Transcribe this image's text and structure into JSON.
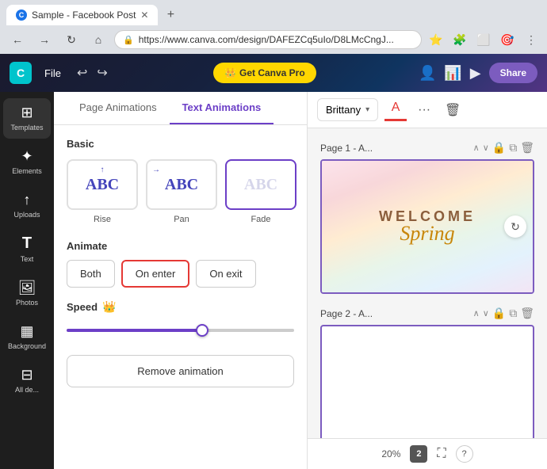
{
  "browser": {
    "tab_title": "Sample - Facebook Post",
    "favicon_letter": "C",
    "url": "https://www.canva.com/design/DAFEZCq5uIo/D8LMcCngJ...",
    "new_tab_icon": "+",
    "back_icon": "←",
    "forward_icon": "→",
    "refresh_icon": "↻",
    "home_icon": "⌂",
    "lock_icon": "🔒"
  },
  "toolbar": {
    "logo_letter": "C",
    "file_label": "File",
    "undo_icon": "↩",
    "redo_icon": "↪",
    "canva_pro_label": "Get Canva Pro",
    "crown_icon": "👑",
    "share_label": "Share",
    "present_icon": "▶"
  },
  "sidebar": {
    "items": [
      {
        "id": "templates",
        "label": "Templates",
        "icon": "⊞"
      },
      {
        "id": "elements",
        "label": "Elements",
        "icon": "✦"
      },
      {
        "id": "uploads",
        "label": "Uploads",
        "icon": "↑"
      },
      {
        "id": "text",
        "label": "Text",
        "icon": "T"
      },
      {
        "id": "photos",
        "label": "Photos",
        "icon": "🖼"
      },
      {
        "id": "background",
        "label": "Background",
        "icon": "▦"
      },
      {
        "id": "all",
        "label": "All de...",
        "icon": "⊟"
      }
    ]
  },
  "panel": {
    "tab_page_animations": "Page Animations",
    "tab_text_animations": "Text Animations",
    "section_basic": "Basic",
    "animations": [
      {
        "id": "rise",
        "label": "Rise",
        "selected": false
      },
      {
        "id": "pan",
        "label": "Pan",
        "selected": false
      },
      {
        "id": "fade",
        "label": "Fade",
        "selected": true
      }
    ],
    "section_animate": "Animate",
    "animate_buttons": [
      {
        "id": "both",
        "label": "Both",
        "selected": false
      },
      {
        "id": "on_enter",
        "label": "On enter",
        "selected": true
      },
      {
        "id": "on_exit",
        "label": "On exit",
        "selected": false
      }
    ],
    "speed_label": "Speed",
    "speed_value": 60,
    "remove_animation_label": "Remove animation"
  },
  "canvas": {
    "font_name": "Brittany",
    "dropdown_arrow": "▾",
    "more_icon": "···",
    "delete_icon": "🗑",
    "page1_title": "Page 1 - A...",
    "page2_title": "Page 2 - A...",
    "welcome_text": "WELCOME",
    "spring_text": "Spring",
    "zoom_level": "20%",
    "page_number": "2",
    "lock_icon": "🔒",
    "copy_icon": "⧉",
    "trash_icon": "🗑",
    "chevron_up": "∧",
    "chevron_down": "∨",
    "refresh_icon": "↻",
    "fullscreen_icon": "⛶",
    "help_icon": "?"
  }
}
